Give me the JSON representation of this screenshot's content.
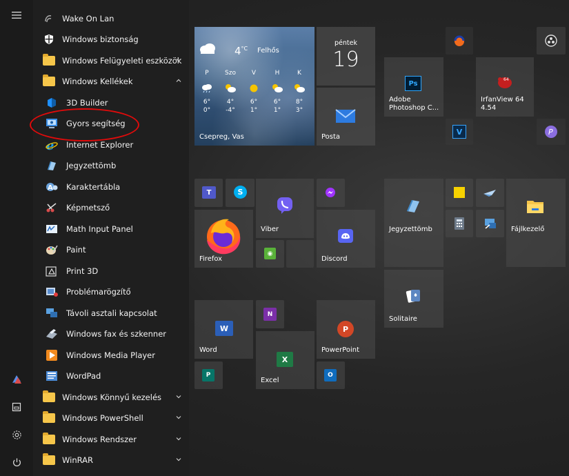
{
  "rail": {
    "icons": [
      "hamburger-menu-icon",
      "user-avatar-icon",
      "documents-icon",
      "settings-gear-icon",
      "power-icon"
    ]
  },
  "apps": [
    {
      "label": "Wake On Lan",
      "icon": "wake-on-lan-icon"
    },
    {
      "label": "Windows biztonság",
      "icon": "shield-icon"
    },
    {
      "label": "Windows Felügyeleti eszközök",
      "icon": "folder-icon",
      "expand": "down"
    },
    {
      "label": "Windows Kellékek",
      "icon": "folder-icon",
      "expand": "up"
    },
    {
      "label": "3D Builder",
      "icon": "3d-builder-icon"
    },
    {
      "label": "Gyors segítség",
      "icon": "quick-assist-icon"
    },
    {
      "label": "Internet Explorer",
      "icon": "internet-explorer-icon"
    },
    {
      "label": "Jegyzettömb",
      "icon": "notepad-icon"
    },
    {
      "label": "Karaktertábla",
      "icon": "character-map-icon"
    },
    {
      "label": "Képmetsző",
      "icon": "snipping-tool-icon"
    },
    {
      "label": "Math Input Panel",
      "icon": "math-input-icon"
    },
    {
      "label": "Paint",
      "icon": "paint-icon"
    },
    {
      "label": "Print 3D",
      "icon": "print-3d-icon"
    },
    {
      "label": "Problémarögzítő",
      "icon": "steps-recorder-icon"
    },
    {
      "label": "Távoli asztali kapcsolat",
      "icon": "remote-desktop-icon"
    },
    {
      "label": "Windows fax és szkenner",
      "icon": "fax-scanner-icon"
    },
    {
      "label": "Windows Media Player",
      "icon": "media-player-icon"
    },
    {
      "label": "WordPad",
      "icon": "wordpad-icon"
    },
    {
      "label": "Windows Könnyű kezelés",
      "icon": "folder-icon",
      "expand": "down"
    },
    {
      "label": "Windows PowerShell",
      "icon": "folder-icon",
      "expand": "down"
    },
    {
      "label": "Windows Rendszer",
      "icon": "folder-icon",
      "expand": "down"
    },
    {
      "label": "WinRAR",
      "icon": "folder-icon",
      "expand": "down"
    }
  ],
  "weather": {
    "temp": "4",
    "unit": "°C",
    "condition": "Felhős",
    "location": "Csepreg, Vas",
    "days": [
      {
        "d": "P",
        "hi": "6°",
        "lo": "0°"
      },
      {
        "d": "Szo",
        "hi": "4°",
        "lo": "-4°"
      },
      {
        "d": "V",
        "hi": "6°",
        "lo": "1°"
      },
      {
        "d": "H",
        "hi": "6°",
        "lo": "1°"
      },
      {
        "d": "K",
        "hi": "8°",
        "lo": "3°"
      }
    ]
  },
  "calendar": {
    "day": "péntek",
    "date": "19"
  },
  "tiles": {
    "posta": "Posta",
    "photoshop": "Adobe Photoshop C...",
    "irfanview": "IrfanView 64 4.54",
    "viber": "Viber",
    "firefox": "Firefox",
    "discord": "Discord",
    "jegyzettomb": "Jegyzettömb",
    "fajlkezelo": "Fájlkezelő",
    "solitaire": "Solitaire",
    "word": "Word",
    "powerpoint": "PowerPoint",
    "excel": "Excel"
  },
  "colors": {
    "highlight": "#e00b0b",
    "accent": "#0078d7"
  }
}
